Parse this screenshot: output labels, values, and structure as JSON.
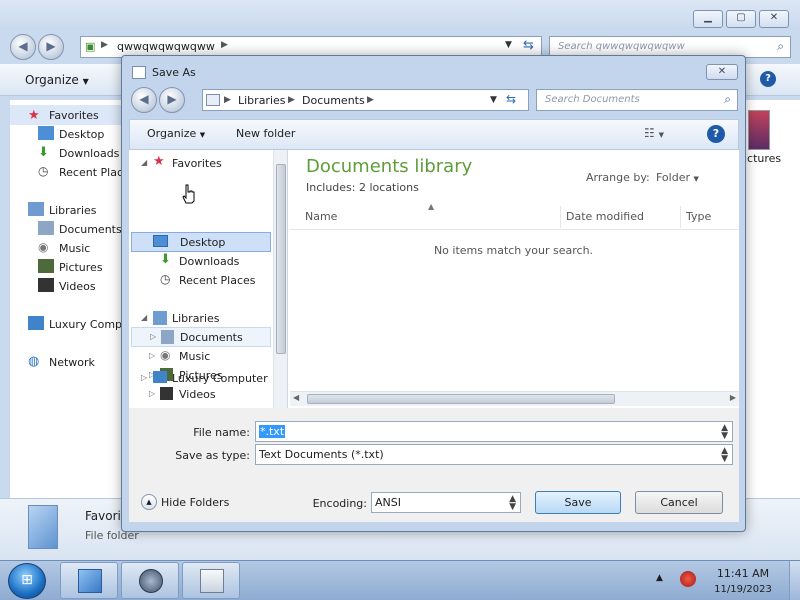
{
  "background_window": {
    "address_path": "qwwqwqwqwqww",
    "search_placeholder": "Search qwwqwqwqwqww",
    "toolbar": {
      "organize": "Organize"
    },
    "nav": {
      "favorites": "Favorites",
      "desktop": "Desktop",
      "downloads": "Downloads",
      "recent_places": "Recent Plac",
      "libraries": "Libraries",
      "documents": "Documents",
      "music": "Music",
      "pictures": "Pictures",
      "videos": "Videos",
      "computer": "Luxury Comp",
      "network": "Network"
    },
    "content_partial_label": "ictures",
    "details": {
      "name": "Favori",
      "type": "File folder"
    }
  },
  "dialog": {
    "title": "Save As",
    "close_glyph": "✕",
    "address": {
      "crumbs": [
        "Libraries",
        "Documents"
      ]
    },
    "search_placeholder": "Search Documents",
    "toolbar": {
      "organize": "Organize",
      "new_folder": "New folder",
      "help": "?"
    },
    "nav": {
      "favorites": "Favorites",
      "desktop": "Desktop",
      "downloads": "Downloads",
      "recent_places": "Recent Places",
      "libraries": "Libraries",
      "documents": "Documents",
      "music": "Music",
      "pictures": "Pictures",
      "videos": "Videos",
      "computer": "Luxury Computer"
    },
    "library": {
      "title": "Documents library",
      "includes_label": "Includes:",
      "includes_value": "2 locations",
      "arrange_label": "Arrange by:",
      "arrange_value": "Folder"
    },
    "columns": [
      "Name",
      "Date modified",
      "Type"
    ],
    "empty_message": "No items match your search.",
    "file_name_label": "File name:",
    "file_name_value": "*.txt",
    "save_as_type_label": "Save as type:",
    "save_as_type_value": "Text Documents (*.txt)",
    "hide_folders": "Hide Folders",
    "encoding_label": "Encoding:",
    "encoding_value": "ANSI",
    "save_button": "Save",
    "cancel_button": "Cancel"
  },
  "taskbar": {
    "time": "11:41 AM",
    "date": "11/19/2023"
  },
  "colors": {
    "library_title": "#5d9d3a",
    "selection": "#3399ff",
    "nav_selected": "#cde0f7"
  }
}
